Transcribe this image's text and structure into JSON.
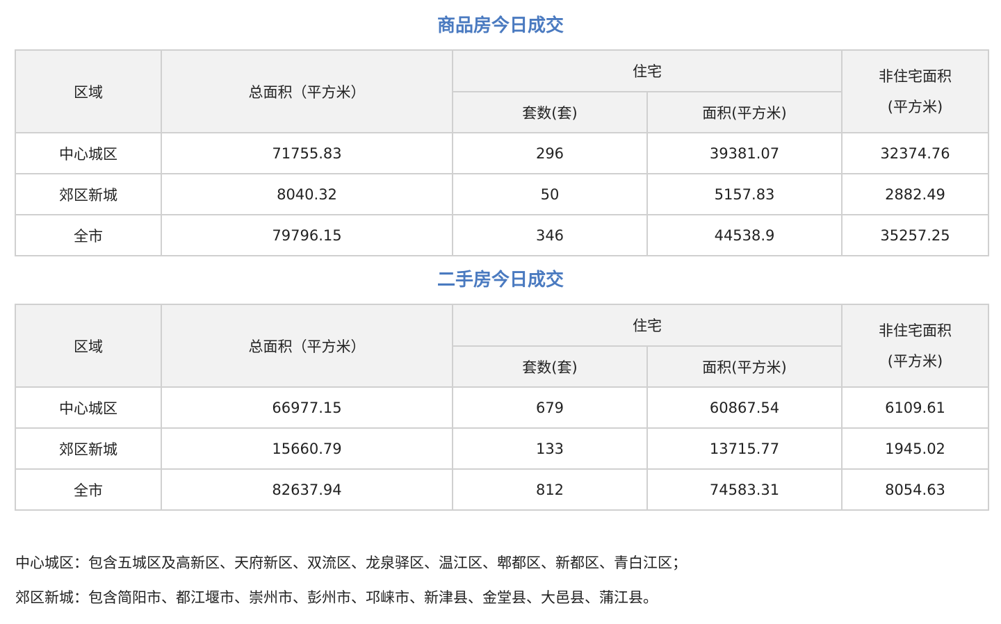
{
  "commercial": {
    "title": "商品房今日成交",
    "headers": {
      "region": "区域",
      "total_area": "总面积（平方米）",
      "residential": "住宅",
      "units": "套数(套)",
      "res_area": "面积(平方米)",
      "nonres_line1": "非住宅面积",
      "nonres_line2": "(平方米)"
    },
    "rows": [
      {
        "region": "中心城区",
        "total_area": "71755.83",
        "units": "296",
        "res_area": "39381.07",
        "nonres_area": "32374.76"
      },
      {
        "region": "郊区新城",
        "total_area": "8040.32",
        "units": "50",
        "res_area": "5157.83",
        "nonres_area": "2882.49"
      },
      {
        "region": "全市",
        "total_area": "79796.15",
        "units": "346",
        "res_area": "44538.9",
        "nonres_area": "35257.25"
      }
    ]
  },
  "secondhand": {
    "title": "二手房今日成交",
    "headers": {
      "region": "区域",
      "total_area": "总面积（平方米）",
      "residential": "住宅",
      "units": "套数(套)",
      "res_area": "面积(平方米)",
      "nonres_line1": "非住宅面积",
      "nonres_line2": "(平方米)"
    },
    "rows": [
      {
        "region": "中心城区",
        "total_area": "66977.15",
        "units": "679",
        "res_area": "60867.54",
        "nonres_area": "6109.61"
      },
      {
        "region": "郊区新城",
        "total_area": "15660.79",
        "units": "133",
        "res_area": "13715.77",
        "nonres_area": "1945.02"
      },
      {
        "region": "全市",
        "total_area": "82637.94",
        "units": "812",
        "res_area": "74583.31",
        "nonres_area": "8054.63"
      }
    ]
  },
  "notes": {
    "central": "中心城区：包含五城区及高新区、天府新区、双流区、龙泉驿区、温江区、郫都区、新都区、青白江区；",
    "suburban": "郊区新城：包含简阳市、都江堰市、崇州市、彭州市、邛崃市、新津县、金堂县、大邑县、蒲江县。"
  },
  "colors": {
    "title": "#4a7ac0",
    "header_bg": "#f2f2f2",
    "border": "#d0d0d0"
  }
}
